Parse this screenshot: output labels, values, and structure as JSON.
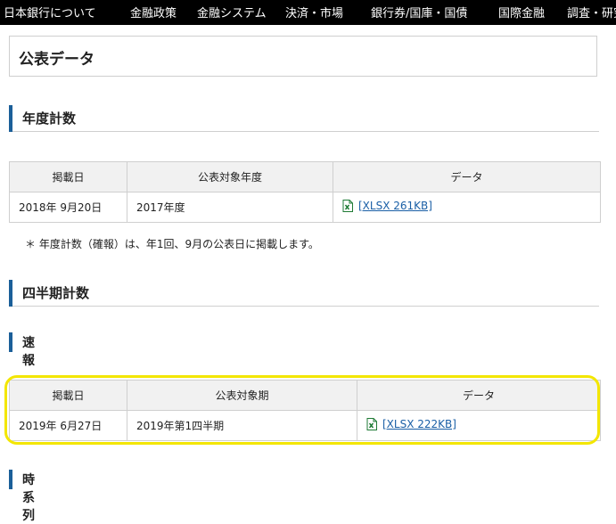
{
  "nav": {
    "items": [
      "日本銀行について",
      "金融政策",
      "金融システム",
      "決済・市場",
      "銀行券/国庫・国債",
      "国際金融",
      "調査・研究"
    ]
  },
  "page": {
    "title": "公表データ"
  },
  "annual": {
    "heading": "年度計数",
    "headers": [
      "掲載日",
      "公表対象年度",
      "データ"
    ],
    "row": {
      "date": "2018年 9月20日",
      "period": "2017年度",
      "link": "[XLSX 261KB]"
    },
    "note": "＊ 年度計数（確報）は、年1回、9月の公表日に掲載します。"
  },
  "quarterly": {
    "heading": "四半期計数",
    "sub_heading": "速報",
    "headers": [
      "掲載日",
      "公表対象期",
      "データ"
    ],
    "row": {
      "date": "2019年 6月27日",
      "period": "2019年第1四半期",
      "link": "[XLSX 222KB]"
    }
  },
  "timeseries": {
    "heading": "時系列"
  },
  "colors": {
    "accent_bar": "#1b5f99",
    "link": "#1a5fa6",
    "highlight": "#f3e600",
    "excel_green": "#1e7a34"
  }
}
